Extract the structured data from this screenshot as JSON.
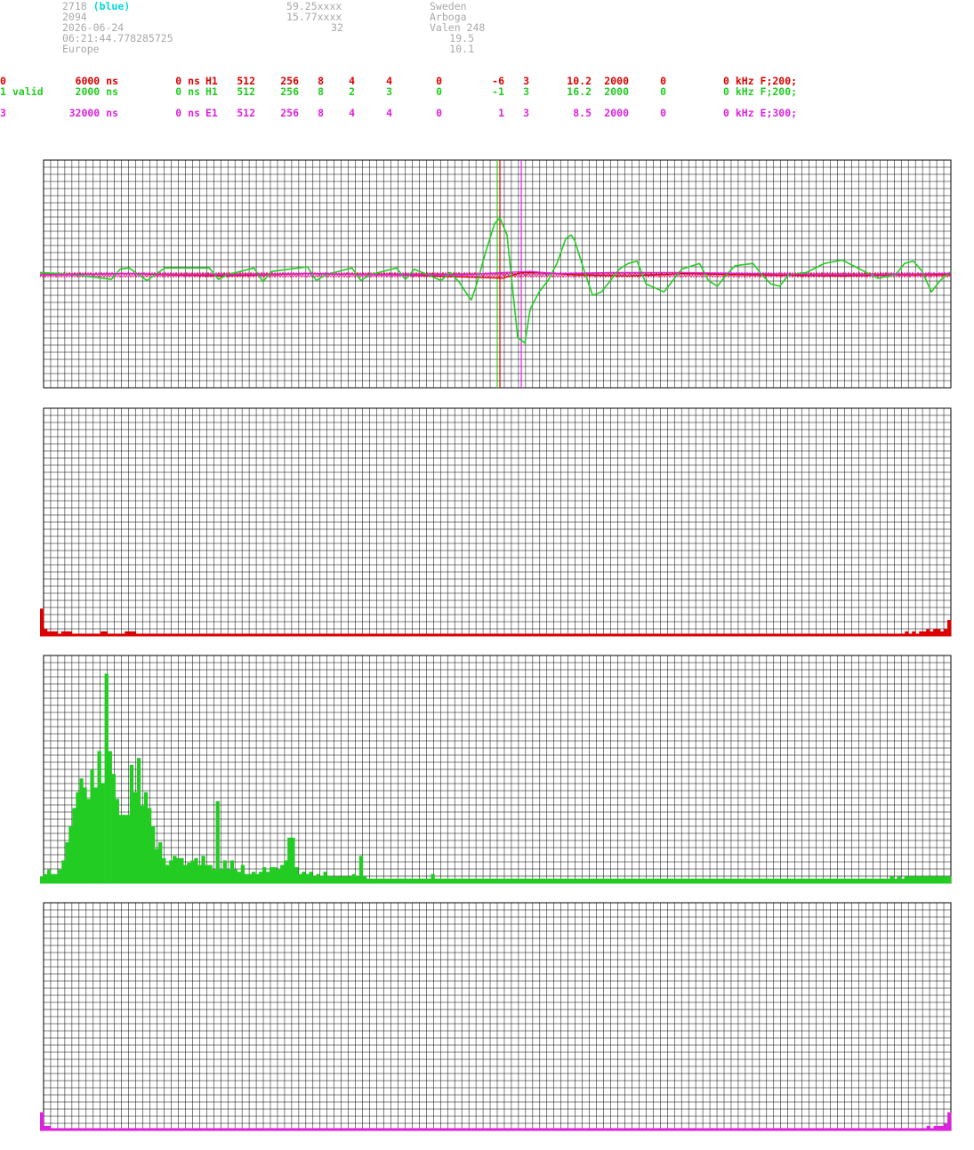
{
  "header": {
    "station_id": "2718",
    "station_tag": "(blue)",
    "number": "2094",
    "date": "2026-06-24",
    "time": "06:21:44.778285725",
    "region": "Europe",
    "lat": "59.25xxxx",
    "lon": "15.77xxxx",
    "alt": "32",
    "country": "Sweden",
    "city": "Arboga",
    "site": "Valen 248",
    "val1": "19.5",
    "val2": "10.1"
  },
  "channels": [
    {
      "id": "0",
      "status": "",
      "window": "6000 ns",
      "offset": "0 ns",
      "type": "H1",
      "c1": "512",
      "c2": "256",
      "c3": "8",
      "c4": "4",
      "c5": "4",
      "c6": "0",
      "c7": "-6",
      "c8": "3",
      "freq": "10.2",
      "c9": "2000",
      "c10": "0",
      "filter": "0 kHz F;200;",
      "color": "#dd0000"
    },
    {
      "id": "1",
      "status": "valid",
      "window": "2000 ns",
      "offset": "0 ns",
      "type": "H1",
      "c1": "512",
      "c2": "256",
      "c3": "8",
      "c4": "2",
      "c5": "3",
      "c6": "0",
      "c7": "-1",
      "c8": "3",
      "freq": "16.2",
      "c9": "2000",
      "c10": "0",
      "filter": "0 kHz F;200;",
      "color": "#22cc22"
    },
    {
      "id": "3",
      "status": "",
      "window": "32000 ns",
      "offset": "0 ns",
      "type": "E1",
      "c1": "512",
      "c2": "256",
      "c3": "8",
      "c4": "4",
      "c5": "4",
      "c6": "0",
      "c7": "1",
      "c8": "3",
      "freq": "8.5",
      "c9": "2000",
      "c10": "0",
      "filter": "0 kHz E;300;",
      "color": "#dd22dd"
    }
  ],
  "chart_data": [
    {
      "type": "line",
      "grid": true,
      "x_range": [
        0,
        511
      ],
      "y_range": [
        -1,
        1
      ],
      "series": [
        {
          "channel": "0",
          "color": "#dd0000",
          "x": [
            0,
            50,
            100,
            150,
            200,
            240,
            260,
            270,
            280,
            300,
            330,
            360,
            400,
            450,
            480,
            511
          ],
          "y": [
            0.0,
            0.01,
            -0.01,
            0.01,
            0.0,
            -0.02,
            -0.03,
            0.02,
            0.02,
            0.0,
            -0.01,
            0.01,
            0.0,
            -0.01,
            0.0,
            0.0
          ]
        },
        {
          "channel": "1",
          "color": "#22cc22",
          "x": [
            0,
            20,
            40,
            45,
            50,
            60,
            70,
            95,
            100,
            105,
            120,
            125,
            130,
            150,
            155,
            160,
            175,
            180,
            185,
            200,
            205,
            210,
            225,
            230,
            235,
            240,
            242,
            245,
            250,
            255,
            258,
            262,
            265,
            268,
            272,
            275,
            280,
            285,
            290,
            295,
            298,
            300,
            305,
            310,
            315,
            320,
            325,
            330,
            335,
            340,
            350,
            360,
            370,
            375,
            380,
            385,
            390,
            400,
            405,
            410,
            415,
            420,
            430,
            440,
            450,
            470,
            480,
            485,
            490,
            495,
            500,
            505,
            511
          ],
          "y": [
            0.02,
            0.0,
            -0.04,
            0.05,
            0.06,
            -0.05,
            0.06,
            0.06,
            -0.04,
            0.0,
            0.06,
            -0.06,
            0.03,
            0.07,
            -0.05,
            0.0,
            0.06,
            -0.05,
            0.0,
            0.06,
            -0.04,
            0.05,
            -0.05,
            0.02,
            -0.06,
            -0.18,
            -0.22,
            -0.08,
            0.2,
            0.45,
            0.5,
            0.35,
            -0.1,
            -0.55,
            -0.6,
            -0.3,
            -0.15,
            -0.05,
            0.1,
            0.32,
            0.35,
            0.3,
            0.05,
            -0.18,
            -0.15,
            -0.05,
            0.05,
            0.1,
            0.12,
            -0.08,
            -0.15,
            0.05,
            0.1,
            -0.05,
            -0.1,
            0.0,
            0.08,
            0.1,
            0.0,
            -0.08,
            -0.1,
            0.0,
            0.02,
            0.1,
            0.13,
            -0.03,
            0.0,
            0.1,
            0.12,
            0.03,
            -0.15,
            -0.05,
            0.03
          ]
        },
        {
          "channel": "3",
          "color": "#dd22dd",
          "x": [
            0,
            50,
            100,
            150,
            200,
            240,
            260,
            275,
            290,
            320,
            360,
            400,
            450,
            511
          ],
          "y": [
            0.0,
            0.01,
            0.0,
            0.01,
            0.0,
            0.0,
            0.02,
            0.03,
            0.01,
            0.02,
            0.02,
            0.01,
            0.0,
            0.01
          ]
        }
      ],
      "markers": [
        {
          "x": 256.5,
          "color": "#22cc22"
        },
        {
          "x": 258,
          "color": "#dd0000"
        },
        {
          "x": 270,
          "color": "#dd22dd"
        }
      ]
    },
    {
      "type": "bar",
      "channel": "0",
      "color": "#dd0000",
      "grid": true,
      "x_range": [
        0,
        255
      ],
      "y_range": [
        0,
        1
      ],
      "values": [
        0.12,
        0.03,
        0.02,
        0.02,
        0.02,
        0.01,
        0.02,
        0.02,
        0.02,
        0.01,
        0.01,
        0.01,
        0.01,
        0.01,
        0.01,
        0.01,
        0.01,
        0.02,
        0.02,
        0.01,
        0.01,
        0.01,
        0.01,
        0.01,
        0.02,
        0.02,
        0.02,
        0.01,
        0.01,
        0.01,
        0.01,
        0.01,
        0.01,
        0.01,
        0.01,
        0.01,
        0.01,
        0.01,
        0.01,
        0.01,
        0.01,
        0.01,
        0.01,
        0.01,
        0.01,
        0.01,
        0.01,
        0.01,
        0.01,
        0.01,
        0.01,
        0.01,
        0.01,
        0.01,
        0.01,
        0.01,
        0.01,
        0.01,
        0.01,
        0.01,
        0.01,
        0.01,
        0.01,
        0.01,
        0.01,
        0.01,
        0.01,
        0.01,
        0.01,
        0.01,
        0.01,
        0.01,
        0.01,
        0.01,
        0.01,
        0.01,
        0.01,
        0.01,
        0.01,
        0.01,
        0.01,
        0.01,
        0.01,
        0.01,
        0.01,
        0.01,
        0.01,
        0.01,
        0.01,
        0.01,
        0.01,
        0.01,
        0.01,
        0.01,
        0.01,
        0.01,
        0.01,
        0.01,
        0.01,
        0.01,
        0.01,
        0.01,
        0.01,
        0.01,
        0.01,
        0.01,
        0.01,
        0.01,
        0.01,
        0.01,
        0.01,
        0.01,
        0.01,
        0.01,
        0.01,
        0.01,
        0.01,
        0.01,
        0.01,
        0.01,
        0.01,
        0.01,
        0.01,
        0.01,
        0.01,
        0.01,
        0.01,
        0.01,
        0.01,
        0.01,
        0.01,
        0.01,
        0.01,
        0.01,
        0.01,
        0.01,
        0.01,
        0.01,
        0.01,
        0.01,
        0.01,
        0.01,
        0.01,
        0.01,
        0.01,
        0.01,
        0.01,
        0.01,
        0.01,
        0.01,
        0.01,
        0.01,
        0.01,
        0.01,
        0.01,
        0.01,
        0.01,
        0.01,
        0.01,
        0.01,
        0.01,
        0.01,
        0.01,
        0.01,
        0.01,
        0.01,
        0.01,
        0.01,
        0.01,
        0.01,
        0.01,
        0.01,
        0.01,
        0.01,
        0.01,
        0.01,
        0.01,
        0.01,
        0.01,
        0.01,
        0.01,
        0.01,
        0.01,
        0.01,
        0.01,
        0.01,
        0.01,
        0.01,
        0.01,
        0.01,
        0.01,
        0.01,
        0.01,
        0.01,
        0.01,
        0.01,
        0.01,
        0.01,
        0.01,
        0.01,
        0.01,
        0.01,
        0.01,
        0.01,
        0.01,
        0.01,
        0.01,
        0.01,
        0.01,
        0.01,
        0.01,
        0.01,
        0.01,
        0.01,
        0.01,
        0.01,
        0.01,
        0.01,
        0.01,
        0.01,
        0.01,
        0.01,
        0.01,
        0.01,
        0.01,
        0.01,
        0.01,
        0.01,
        0.01,
        0.01,
        0.01,
        0.01,
        0.01,
        0.01,
        0.01,
        0.01,
        0.01,
        0.01,
        0.01,
        0.01,
        0.01,
        0.01,
        0.01,
        0.01,
        0.01,
        0.02,
        0.01,
        0.02,
        0.01,
        0.02,
        0.02,
        0.03,
        0.02,
        0.03,
        0.03,
        0.02,
        0.03,
        0.07
      ]
    },
    {
      "type": "bar",
      "channel": "1",
      "color": "#22cc22",
      "grid": true,
      "x_range": [
        0,
        255
      ],
      "y_range": [
        0,
        1
      ],
      "values": [
        0.03,
        0.04,
        0.06,
        0.04,
        0.04,
        0.06,
        0.1,
        0.18,
        0.25,
        0.33,
        0.4,
        0.46,
        0.42,
        0.37,
        0.5,
        0.42,
        0.58,
        0.44,
        0.92,
        0.58,
        0.48,
        0.37,
        0.3,
        0.3,
        0.3,
        0.52,
        0.4,
        0.55,
        0.34,
        0.4,
        0.33,
        0.25,
        0.15,
        0.18,
        0.11,
        0.08,
        0.1,
        0.12,
        0.11,
        0.11,
        0.08,
        0.09,
        0.1,
        0.11,
        0.08,
        0.12,
        0.08,
        0.08,
        0.06,
        0.36,
        0.06,
        0.1,
        0.06,
        0.1,
        0.06,
        0.05,
        0.08,
        0.04,
        0.04,
        0.05,
        0.04,
        0.05,
        0.07,
        0.05,
        0.07,
        0.07,
        0.06,
        0.08,
        0.1,
        0.2,
        0.2,
        0.07,
        0.04,
        0.05,
        0.04,
        0.05,
        0.03,
        0.04,
        0.03,
        0.05,
        0.03,
        0.03,
        0.03,
        0.03,
        0.03,
        0.03,
        0.03,
        0.04,
        0.03,
        0.12,
        0.03,
        0.02,
        0.02,
        0.02,
        0.02,
        0.02,
        0.02,
        0.02,
        0.02,
        0.02,
        0.02,
        0.02,
        0.02,
        0.02,
        0.02,
        0.02,
        0.02,
        0.02,
        0.02,
        0.04,
        0.02,
        0.02,
        0.02,
        0.02,
        0.02,
        0.02,
        0.02,
        0.02,
        0.02,
        0.02,
        0.02,
        0.02,
        0.02,
        0.02,
        0.02,
        0.02,
        0.02,
        0.02,
        0.02,
        0.02,
        0.02,
        0.02,
        0.02,
        0.02,
        0.02,
        0.02,
        0.02,
        0.02,
        0.02,
        0.02,
        0.02,
        0.02,
        0.02,
        0.02,
        0.02,
        0.02,
        0.02,
        0.02,
        0.02,
        0.02,
        0.02,
        0.02,
        0.02,
        0.02,
        0.02,
        0.02,
        0.02,
        0.02,
        0.02,
        0.02,
        0.02,
        0.02,
        0.02,
        0.02,
        0.02,
        0.02,
        0.02,
        0.02,
        0.02,
        0.02,
        0.02,
        0.02,
        0.02,
        0.02,
        0.02,
        0.02,
        0.02,
        0.02,
        0.02,
        0.02,
        0.02,
        0.02,
        0.02,
        0.02,
        0.02,
        0.02,
        0.02,
        0.02,
        0.02,
        0.02,
        0.02,
        0.02,
        0.02,
        0.02,
        0.02,
        0.02,
        0.02,
        0.02,
        0.02,
        0.02,
        0.02,
        0.02,
        0.02,
        0.02,
        0.02,
        0.02,
        0.02,
        0.02,
        0.02,
        0.02,
        0.02,
        0.02,
        0.02,
        0.02,
        0.02,
        0.02,
        0.02,
        0.02,
        0.02,
        0.02,
        0.02,
        0.02,
        0.02,
        0.02,
        0.02,
        0.02,
        0.02,
        0.02,
        0.02,
        0.02,
        0.02,
        0.02,
        0.02,
        0.02,
        0.02,
        0.02,
        0.02,
        0.03,
        0.02,
        0.03,
        0.02,
        0.03,
        0.03,
        0.03,
        0.03,
        0.03,
        0.03,
        0.03,
        0.03,
        0.03,
        0.03,
        0.03,
        0.03,
        0.03
      ]
    },
    {
      "type": "bar",
      "channel": "3",
      "color": "#dd22dd",
      "grid": true,
      "x_range": [
        0,
        255
      ],
      "y_range": [
        0,
        1
      ],
      "values": [
        0.08,
        0.02,
        0.02,
        0.01,
        0.01,
        0.01,
        0.01,
        0.01,
        0.01,
        0.01,
        0.01,
        0.01,
        0.01,
        0.01,
        0.01,
        0.01,
        0.01,
        0.01,
        0.01,
        0.01,
        0.01,
        0.01,
        0.01,
        0.01,
        0.01,
        0.01,
        0.01,
        0.01,
        0.01,
        0.01,
        0.01,
        0.01,
        0.01,
        0.01,
        0.01,
        0.01,
        0.01,
        0.01,
        0.01,
        0.01,
        0.01,
        0.01,
        0.01,
        0.01,
        0.01,
        0.01,
        0.01,
        0.01,
        0.01,
        0.01,
        0.01,
        0.01,
        0.01,
        0.01,
        0.01,
        0.01,
        0.01,
        0.01,
        0.01,
        0.01,
        0.01,
        0.01,
        0.01,
        0.01,
        0.01,
        0.01,
        0.01,
        0.01,
        0.01,
        0.01,
        0.01,
        0.01,
        0.01,
        0.01,
        0.01,
        0.01,
        0.01,
        0.01,
        0.01,
        0.01,
        0.01,
        0.01,
        0.01,
        0.01,
        0.01,
        0.01,
        0.01,
        0.01,
        0.01,
        0.01,
        0.01,
        0.01,
        0.01,
        0.01,
        0.01,
        0.01,
        0.01,
        0.01,
        0.01,
        0.01,
        0.01,
        0.01,
        0.01,
        0.01,
        0.01,
        0.01,
        0.01,
        0.01,
        0.01,
        0.01,
        0.01,
        0.01,
        0.01,
        0.01,
        0.01,
        0.01,
        0.01,
        0.01,
        0.01,
        0.01,
        0.01,
        0.01,
        0.01,
        0.01,
        0.01,
        0.01,
        0.01,
        0.01,
        0.01,
        0.01,
        0.01,
        0.01,
        0.01,
        0.01,
        0.01,
        0.01,
        0.01,
        0.01,
        0.01,
        0.01,
        0.01,
        0.01,
        0.01,
        0.01,
        0.01,
        0.01,
        0.01,
        0.01,
        0.01,
        0.01,
        0.01,
        0.01,
        0.01,
        0.01,
        0.01,
        0.01,
        0.01,
        0.01,
        0.01,
        0.01,
        0.01,
        0.01,
        0.01,
        0.01,
        0.01,
        0.01,
        0.01,
        0.01,
        0.01,
        0.01,
        0.01,
        0.01,
        0.01,
        0.01,
        0.01,
        0.01,
        0.01,
        0.01,
        0.01,
        0.01,
        0.01,
        0.01,
        0.01,
        0.01,
        0.01,
        0.01,
        0.01,
        0.01,
        0.01,
        0.01,
        0.01,
        0.01,
        0.01,
        0.01,
        0.01,
        0.01,
        0.01,
        0.01,
        0.01,
        0.01,
        0.01,
        0.01,
        0.01,
        0.01,
        0.01,
        0.01,
        0.01,
        0.01,
        0.01,
        0.01,
        0.01,
        0.01,
        0.01,
        0.01,
        0.01,
        0.01,
        0.01,
        0.01,
        0.01,
        0.01,
        0.01,
        0.01,
        0.01,
        0.01,
        0.01,
        0.01,
        0.01,
        0.01,
        0.01,
        0.01,
        0.01,
        0.01,
        0.01,
        0.01,
        0.01,
        0.01,
        0.01,
        0.01,
        0.01,
        0.01,
        0.01,
        0.01,
        0.01,
        0.01,
        0.01,
        0.01,
        0.01,
        0.01,
        0.01,
        0.01,
        0.01,
        0.01,
        0.01,
        0.01,
        0.01,
        0.01,
        0.02,
        0.01,
        0.02,
        0.02,
        0.02,
        0.03,
        0.08
      ]
    }
  ]
}
